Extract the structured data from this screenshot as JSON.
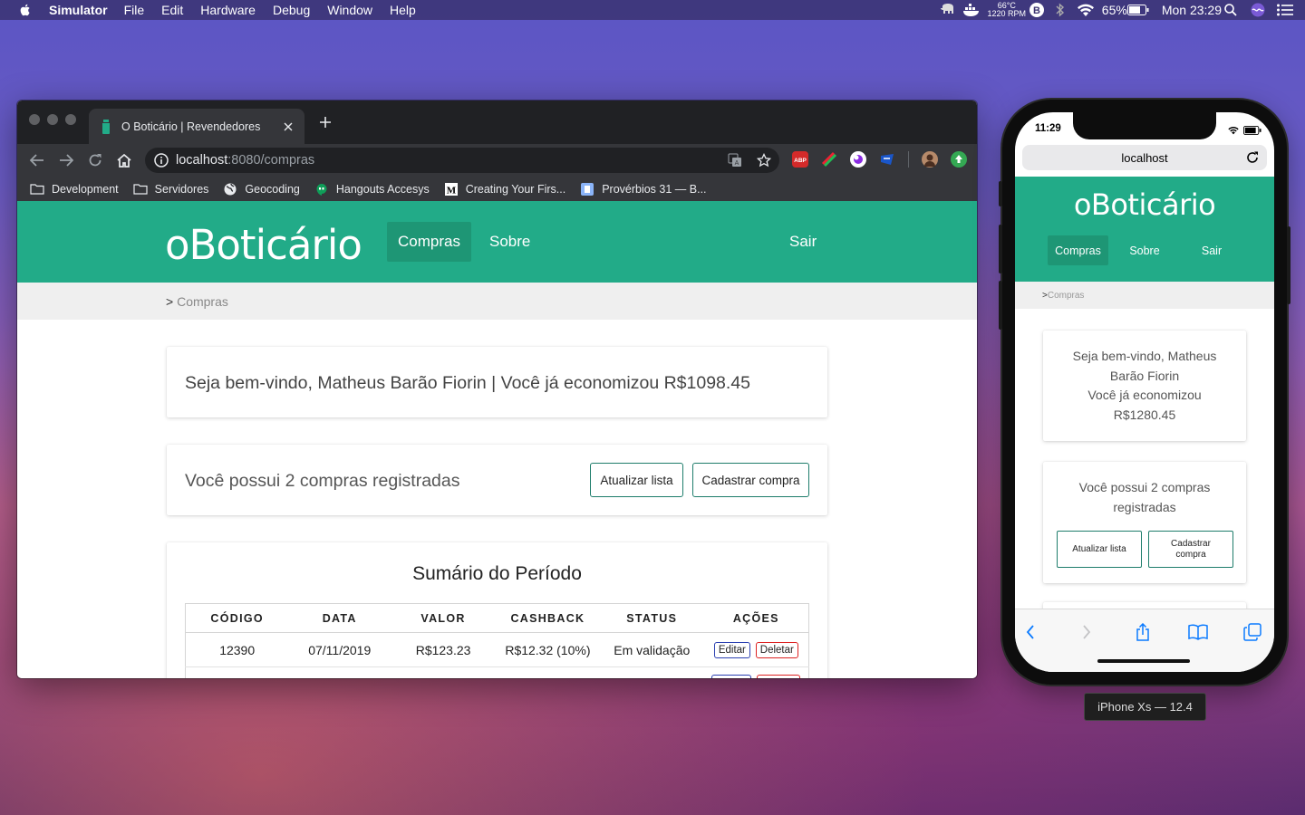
{
  "menubar": {
    "app_name": "Simulator",
    "menus": [
      "File",
      "Edit",
      "Hardware",
      "Debug",
      "Window",
      "Help"
    ],
    "temp_line1": "66°C",
    "temp_line2": "1220 RPM",
    "battery": "65%",
    "clock": "Mon 23:29"
  },
  "browser": {
    "tab_title": "O Boticário | Revendedores",
    "url_host": "localhost",
    "url_path": ":8080/compras",
    "bookmarks": [
      "Development",
      "Servidores",
      "Geocoding",
      "Hangouts Accesys",
      "Creating Your Firs...",
      "Provérbios 31 — B..."
    ]
  },
  "site": {
    "logo": "oBoticário",
    "nav": {
      "compras": "Compras",
      "sobre": "Sobre",
      "sair": "Sair"
    },
    "breadcrumb_sep": ">",
    "breadcrumb_current": "Compras",
    "welcome": "Seja bem-vindo, Matheus Barão Fiorin | Você já economizou R$1098.45",
    "count_text": "Você possui 2 compras registradas",
    "btn_refresh": "Atualizar lista",
    "btn_register": "Cadastrar compra",
    "summary_title": "Sumário do Período",
    "table": {
      "headers": [
        "CÓDIGO",
        "DATA",
        "VALOR",
        "CASHBACK",
        "STATUS",
        "AÇÕES"
      ],
      "rows": [
        {
          "codigo": "12390",
          "data": "07/11/2019",
          "valor": "R$123.23",
          "cashback": "R$12.32 (10%)",
          "status": "Em validação",
          "edit": "Editar",
          "delete": "Deletar"
        }
      ]
    }
  },
  "iphone": {
    "time": "11:29",
    "url": "localhost",
    "logo": "oBoticário",
    "nav": {
      "compras": "Compras",
      "sobre": "Sobre",
      "sair": "Sair"
    },
    "breadcrumb_sep": ">",
    "breadcrumb_current": "Compras",
    "welcome_lines": [
      "Seja bem-vindo, Matheus",
      "Barão Fiorin",
      "Você já economizou",
      "R$1280.45"
    ],
    "count_lines": [
      "Você possui 2 compras",
      "registradas"
    ],
    "btn_refresh": "Atualizar lista",
    "btn_register_lines": [
      "Cadastrar",
      "compra"
    ],
    "device_label": "iPhone Xs — 12.4"
  },
  "colors": {
    "brand_green": "#22ab88",
    "brand_green_dark": "#1e9675"
  }
}
